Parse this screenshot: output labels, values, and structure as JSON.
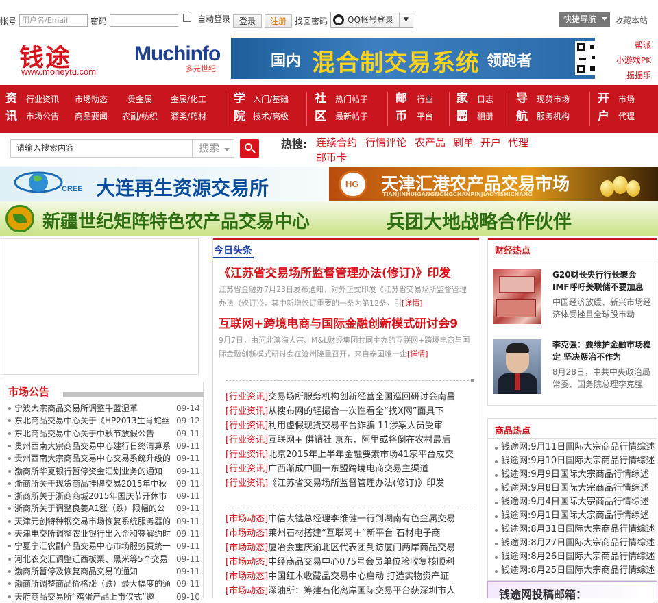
{
  "topbar": {
    "account_label": "帐号",
    "username_placeholder": "用户名/Email",
    "password_label": "密码",
    "auto_login_label": "自动登录",
    "login_button": "登录",
    "register_button": "注册",
    "recover_link": "找回密码",
    "qq_login": "QQ帐号登录",
    "quick_nav": "快捷导航",
    "favorite": "收藏本站"
  },
  "header": {
    "logo_text": "钱途",
    "logo_url": "www.moneytu.com",
    "partner_logo": "Muchinfo",
    "partner_logo_sub": "多元世纪",
    "banner_left": "国内",
    "banner_main": "混合制交易系统",
    "banner_right": "领跑者",
    "side_links": [
      "帮派",
      "小游戏PK",
      "摇摇乐"
    ]
  },
  "nav": {
    "groups": [
      {
        "big": [
          "资",
          "讯"
        ],
        "items": [
          [
            "行业资讯",
            "市场动态",
            "贵金属",
            "金属/化工"
          ],
          [
            "市场公告",
            "商品要闻",
            "农副/纺织",
            "酒类/药材"
          ]
        ]
      },
      {
        "big": [
          "学",
          "院"
        ],
        "items": [
          [
            "入门/基础"
          ],
          [
            "技术/高级"
          ]
        ]
      },
      {
        "big": [
          "社",
          "区"
        ],
        "items": [
          [
            "热门帖子"
          ],
          [
            "最新帖子"
          ]
        ]
      },
      {
        "big": [
          "邮",
          "币"
        ],
        "items": [
          [
            "行业"
          ],
          [
            "平台"
          ]
        ]
      },
      {
        "big": [
          "家",
          "园"
        ],
        "items": [
          [
            "日志"
          ],
          [
            "相册"
          ]
        ]
      },
      {
        "big": [
          "导",
          "航"
        ],
        "items": [
          [
            "现货市场"
          ],
          [
            "服务机构"
          ]
        ]
      },
      {
        "big": [
          "开",
          "户"
        ],
        "items": [
          [
            "市场"
          ],
          [
            "代理"
          ]
        ]
      }
    ]
  },
  "search": {
    "placeholder": "请输入搜索内容",
    "select_label": "搜索",
    "hot_label": "热搜:",
    "hot_words": [
      "连续合约",
      "行情评论",
      "农产品",
      "刷单",
      "开户",
      "代理",
      "邮币卡"
    ]
  },
  "ads": {
    "ad1": "大连再生资源交易所",
    "ad1_logo": "CREE",
    "ad2": "天津汇港农产品交易市场",
    "ad2_sub": "TIANJINHUIGANGNONGCHANPINJIAOYISHICHANG",
    "ad2_logo": "HG",
    "ad3_left": "新疆世纪矩阵特色农产品交易中心",
    "ad3_right": "兵团大地战略合作伙伴"
  },
  "market_notice": {
    "title": "市场公告",
    "items": [
      {
        "title": "宁波大宗商品交易所调整牛蓝湿革",
        "date": "09-14"
      },
      {
        "title": "东北商品交易中心关于《HP2013生肖蛇丝",
        "date": "09-12"
      },
      {
        "title": "东北商品交易中心关于中秋节放假公告",
        "date": "09-11"
      },
      {
        "title": "贵州西南大宗商品交易中心建行日终清算系",
        "date": "09-11"
      },
      {
        "title": "贵州西南大宗商品交易中心交易系统升级的",
        "date": "09-11"
      },
      {
        "title": "渤商所华夏银行暂停资金汇划业务的通知",
        "date": "09-11"
      },
      {
        "title": "浙商所关于现货商品挂牌交易2015年中秋",
        "date": "09-11"
      },
      {
        "title": "浙商所关于浙商商城2015年国庆节开休市",
        "date": "09-11"
      },
      {
        "title": "浙商所关于调整良姜A1涨（跌）限幅的公",
        "date": "09-11"
      },
      {
        "title": "天津元创特种钢交易市场恢复系统服务器的",
        "date": "09-11"
      },
      {
        "title": "天津电交所调整农业银行出入金和签解约时",
        "date": "09-11"
      },
      {
        "title": "宁夏宁汇农副产品交易中心市场服务费统一",
        "date": "09-11"
      },
      {
        "title": "河北农交汇调整迁西板栗、黑米等5个交易",
        "date": "09-11"
      },
      {
        "title": "渤商所暂停及恢复商品交易的通知",
        "date": "09-11"
      },
      {
        "title": "渤商所调整商品价格涨（跌）最大幅度的通",
        "date": "09-11"
      },
      {
        "title": "天府商品交易所“鸡蛋产品上市仪式”邀",
        "date": "09-10"
      }
    ]
  },
  "today": {
    "tab": "今日头条",
    "headline1": "《江苏省交易场所监督管理办法(修订)》印发",
    "summary1": "江苏省金融办7月23日发布通知，对外正式印发《江苏省交易场所监督管理办法（修订）》，其中新增修订重要的一条为第12条，引",
    "headline2": "互联网+跨境电商与国际金融创新模式研讨会9",
    "summary2": "9月7日，由河北滨海大宗、M&L财经集团共同主办的互联网+跨境电商与国际金融创新模式研讨会在沧州隆重召开，来自泰国唯一企",
    "detail_label": "[详情]",
    "industry": [
      {
        "cat": "[行业资讯]",
        "title": "交易场所服务机构创新经营全国巡回研讨会南昌"
      },
      {
        "cat": "[行业资讯]",
        "title": "从搜布网的轻撮合一次性看全“找X网”面具下"
      },
      {
        "cat": "[行业资讯]",
        "title": "利用虚假现货交易平台诈骗 11涉案人员受审"
      },
      {
        "cat": "[行业资讯]",
        "title": "互联网+ 供销社 京东，阿里或将倒在农村最后"
      },
      {
        "cat": "[行业资讯]",
        "title": "北京2015年上半年金融要素市场41家平台成交"
      },
      {
        "cat": "[行业资讯]",
        "title": "广西渐成中国一东盟跨境电商交易主渠道"
      },
      {
        "cat": "[行业资讯]",
        "title": "《江苏省交易场所监督管理办法(修订)》印发"
      }
    ],
    "market": [
      {
        "cat": "[市场动态]",
        "title": "中信大锰总经理李维健一行到湖南有色金属交易"
      },
      {
        "cat": "[市场动态]",
        "title": "莱州石材搭建“互联网＋”新平台 石材电子商"
      },
      {
        "cat": "[市场动态]",
        "title": "厦冶会重庆渝北区代表团到访厦门两岸商品交易"
      },
      {
        "cat": "[市场动态]",
        "title": "中经商品交易中心075号会员单位验收复核顺利"
      },
      {
        "cat": "[市场动态]",
        "title": "中国红木收藏品交易中心启动 打造实物资产证"
      },
      {
        "cat": "[市场动态]",
        "title": "深油所：筹建石化离岸国际交易平台获深圳市人"
      }
    ]
  },
  "finance_hot": {
    "title": "财经热点",
    "items": [
      {
        "title": "G20财长央行行长聚会 IMF呼吁美联储不要加息",
        "summary": "中国经济放缓、新兴市场经济体受挫且全球股市动"
      },
      {
        "title": "李克强：要维护金融市场稳定 坚决惩治不作为",
        "summary": "8月28日，中共中央政治局常委、国务院总理李克强"
      }
    ]
  },
  "commodity_hot": {
    "title": "商品热点",
    "items": [
      "钱途网:9月11日国际大宗商品行情综述",
      "钱途网:9月10日国际大宗商品行情综述",
      "钱途网:9月9日国际大宗商品行情综述",
      "钱途网:9月8日国际大宗商品行情综述",
      "钱途网:9月4日国际大宗商品行情综述",
      "钱途网:9月1日国际大宗商品行情综述",
      "钱途网:8月31日国际大宗商品行情综述",
      "钱途网:8月27日国际大宗商品行情综述",
      "钱途网:8月26日国际大宗商品行情综述",
      "钱途网:8月25日国际大宗商品行情综述"
    ]
  },
  "tougao": "钱途网投稿邮箱："
}
